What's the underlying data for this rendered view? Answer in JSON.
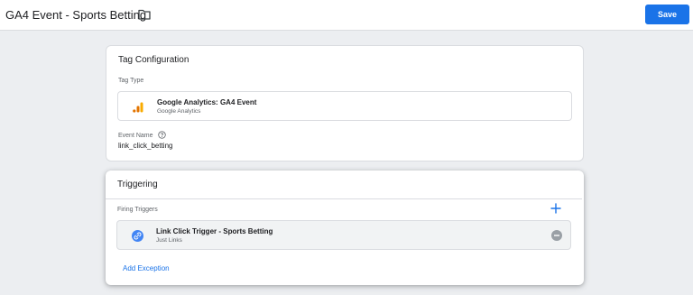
{
  "header": {
    "title": "GA4 Event - Sports Betting",
    "folder_icon": "folder-icon",
    "save_label": "Save"
  },
  "tag_configuration": {
    "title": "Tag Configuration",
    "tag_type_label": "Tag Type",
    "tag_type": {
      "icon": "google-analytics-icon",
      "name": "Google Analytics: GA4 Event",
      "provider": "Google Analytics"
    },
    "event_name_label": "Event Name",
    "event_name_help_icon": "help-icon",
    "event_name_value": "link_click_betting"
  },
  "triggering": {
    "title": "Triggering",
    "firing_triggers_label": "Firing Triggers",
    "add_icon": "plus-icon",
    "triggers": [
      {
        "icon": "link-icon",
        "name": "Link Click Trigger - Sports Betting",
        "type": "Just Links",
        "remove_icon": "remove-icon"
      }
    ],
    "add_exception_label": "Add Exception"
  },
  "colors": {
    "accent": "#1a73e8",
    "background": "#eceef1",
    "ga_orange": "#f9ab00",
    "ga_dark_orange": "#e37400",
    "link_blue": "#4285f4",
    "remove_gray": "#9aa0a6"
  }
}
